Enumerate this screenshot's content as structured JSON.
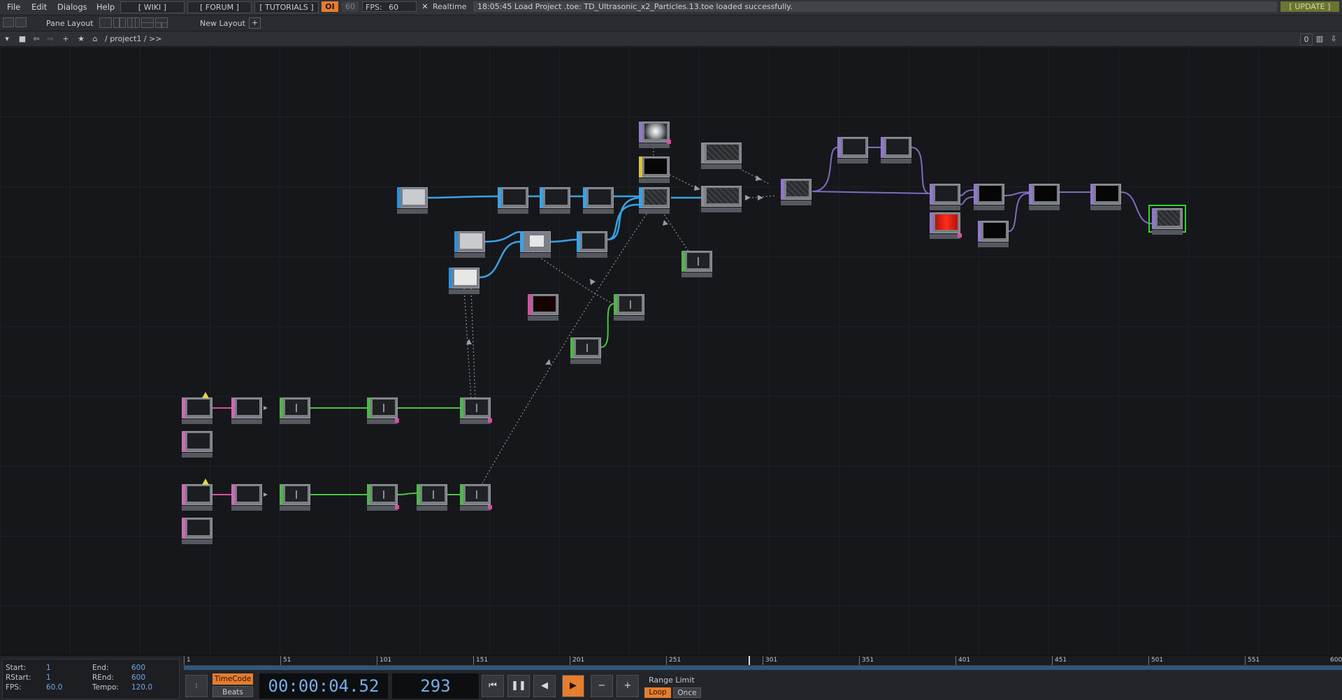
{
  "menubar": {
    "items": [
      "File",
      "Edit",
      "Dialogs",
      "Help"
    ],
    "links": [
      "[ WIKI ]",
      "[ FORUM ]",
      "[ TUTORIALS ]"
    ],
    "oi_label": "OI",
    "fps_cook": "60",
    "fps_label": "FPS:",
    "fps_value": "60",
    "realtime_label": "Realtime",
    "realtime_check": "✕",
    "status_message": "18:05:45 Load Project .toe: TD_Ultrasonic_x2_Particles.13.toe loaded successfully.",
    "update_label": "[ UPDATE ]"
  },
  "panebar": {
    "pane_layout_label": "Pane Layout",
    "new_layout_label": "New Layout",
    "add_label": "+"
  },
  "pathbar": {
    "path": "/ project1 / >>",
    "right_buttons": [
      "0",
      "▥",
      "⇩"
    ]
  },
  "timeline": {
    "ruler_ticks": [
      "1",
      "51",
      "101",
      "151",
      "201",
      "251",
      "301",
      "351",
      "401",
      "451",
      "501",
      "551",
      "600"
    ],
    "info": {
      "start_label": "Start:",
      "start_value": "1",
      "end_label": "End:",
      "end_value": "600",
      "rstart_label": "RStart:",
      "rstart_value": "1",
      "rend_label": "REnd:",
      "rend_value": "600",
      "fps_label": "FPS:",
      "fps_value": "60.0",
      "tempo_label": "Tempo:",
      "tempo_value": "120.0"
    },
    "timecode_label": "TimeCode",
    "beats_label": "Beats",
    "timecode": "00:00:04.52",
    "frame": "293",
    "controls": [
      "⏮",
      "❚❚",
      "◀",
      "▶",
      "−",
      "+"
    ],
    "range_limit_label": "Range Limit",
    "loop_label": "Loop",
    "once_label": "Once"
  },
  "colors": {
    "top": "#3aa2e4",
    "chop": "#52b44d",
    "sop": "#2f8fd7",
    "dat": "#cc6ab5",
    "comp": "#9078c9",
    "mat": "#d8c43a",
    "wire_top": "#3aa2e4",
    "wire_chop": "#47c63f",
    "wire_comp": "#7f6bc3"
  }
}
